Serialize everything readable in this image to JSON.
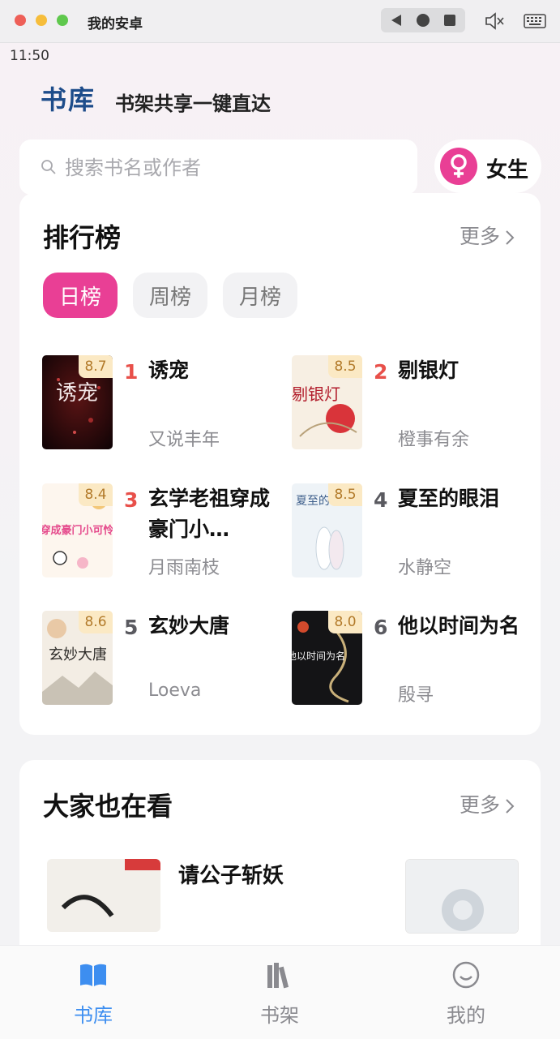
{
  "window": {
    "title": "我的安卓"
  },
  "status_bar": {
    "time": "11:50"
  },
  "header": {
    "brand": "书库",
    "slogan": "书架共享一键直达"
  },
  "search": {
    "placeholder": "搜索书名或作者"
  },
  "gender_toggle": {
    "label": "女生",
    "icon": "female-icon",
    "color": "#e93f95"
  },
  "ranking": {
    "title": "排行榜",
    "more": "更多",
    "tabs": [
      {
        "label": "日榜",
        "active": true
      },
      {
        "label": "周榜",
        "active": false
      },
      {
        "label": "月榜",
        "active": false
      }
    ],
    "books": [
      {
        "rank": "1",
        "title": "诱宠",
        "author": "又说丰年",
        "score": "8.7",
        "cover_text": "诱宠"
      },
      {
        "rank": "2",
        "title": "剔银灯",
        "author": "橙事有余",
        "score": "8.5",
        "cover_text": "剔银灯"
      },
      {
        "rank": "3",
        "title": "玄学老祖穿成豪门小…",
        "author": "月雨南枝",
        "score": "8.4",
        "cover_text": "穿成豪门小可怜"
      },
      {
        "rank": "4",
        "title": "夏至的眼泪",
        "author": "水静空",
        "score": "8.5",
        "cover_text": "夏至的"
      },
      {
        "rank": "5",
        "title": "玄妙大唐",
        "author": "Loeva",
        "score": "8.6",
        "cover_text": "玄妙大唐"
      },
      {
        "rank": "6",
        "title": "他以时间为名",
        "author": "殷寻",
        "score": "8.0",
        "cover_text": "他以时间为名"
      }
    ]
  },
  "also_watching": {
    "title": "大家也在看",
    "more": "更多",
    "books": [
      {
        "title": "请公子斩妖"
      }
    ]
  },
  "tabbar": {
    "items": [
      {
        "label": "书库",
        "icon": "book-open-icon",
        "active": true
      },
      {
        "label": "书架",
        "icon": "bookshelf-icon",
        "active": false
      },
      {
        "label": "我的",
        "icon": "smiley-icon",
        "active": false
      }
    ]
  },
  "colors": {
    "accent": "#e93f95",
    "brand": "#1d4c8a",
    "tab_active": "#3d8ef0",
    "rank_top": "#e8504a"
  }
}
